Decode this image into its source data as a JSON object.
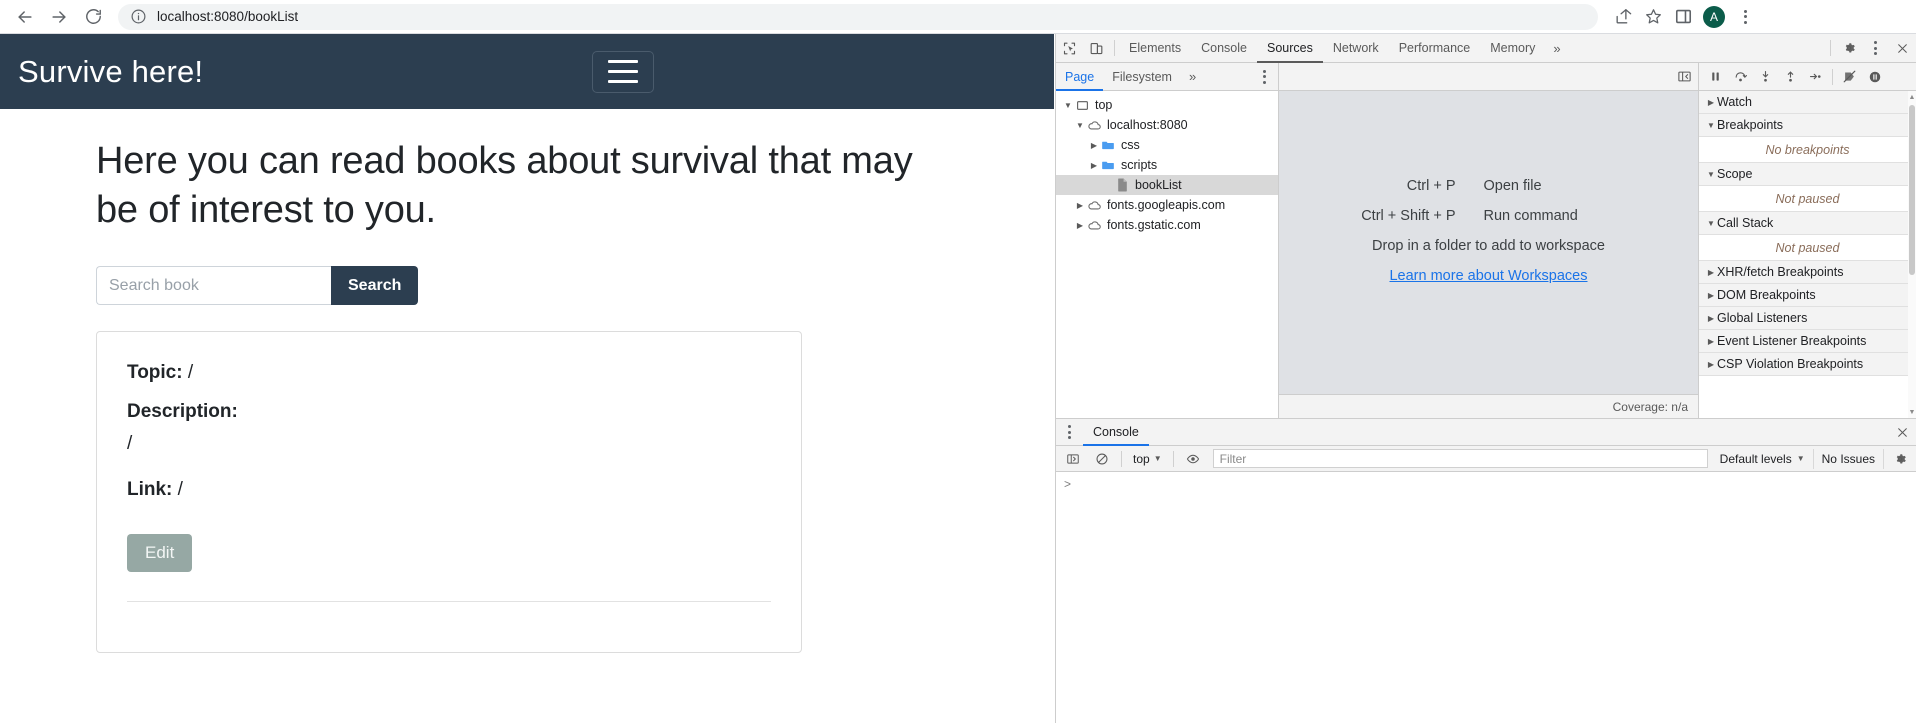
{
  "browser": {
    "back_icon": "arrow-left-icon",
    "forward_icon": "arrow-right-icon",
    "reload_icon": "reload-icon",
    "info_icon": "page-info-icon",
    "url_host": "localhost:8080",
    "url_path": "/bookList",
    "url_full": "localhost:8080/bookList",
    "share_icon": "share-icon",
    "bookmark_icon": "star-icon",
    "side_panel_icon": "side-panel-icon",
    "avatar_letter": "A",
    "menu_icon": "three-dot-menu-icon"
  },
  "page": {
    "header": {
      "title": "Survive here!",
      "toggler_icon": "hamburger-menu-icon",
      "background_color": "#2c3e50"
    },
    "lead": "Here you can read books about survival that may be of interest to you.",
    "search": {
      "placeholder": "Search book",
      "value": "",
      "button_label": "Search",
      "button_color": "#2c3e50"
    },
    "book": {
      "topic_label": "Topic:",
      "topic_value": "/",
      "description_label": "Description:",
      "description_value": "/",
      "link_label": "Link:",
      "link_value": "/",
      "edit_label": "Edit",
      "edit_color": "#96a8a4"
    }
  },
  "devtools": {
    "inspect_icon": "inspect-element-icon",
    "device_icon": "device-toolbar-icon",
    "tabs": [
      {
        "label": "Elements",
        "active": false
      },
      {
        "label": "Console",
        "active": false
      },
      {
        "label": "Sources",
        "active": true
      },
      {
        "label": "Network",
        "active": false
      },
      {
        "label": "Performance",
        "active": false
      },
      {
        "label": "Memory",
        "active": false
      }
    ],
    "more_tabs_icon": "chevron-double-right-icon",
    "settings_icon": "gear-icon",
    "more_options_icon": "three-dot-menu-icon",
    "close_icon": "close-icon",
    "navigator": {
      "tabs": [
        {
          "label": "Page",
          "active": true
        },
        {
          "label": "Filesystem",
          "active": false
        }
      ],
      "more_icon": "chevron-double-right-icon",
      "options_icon": "three-dot-menu-icon",
      "tree": [
        {
          "label": "top",
          "icon": "frame-icon",
          "depth": 0,
          "expanded": true,
          "selected": false
        },
        {
          "label": "localhost:8080",
          "icon": "cloud-icon",
          "depth": 1,
          "expanded": true,
          "selected": false
        },
        {
          "label": "css",
          "icon": "folder-icon",
          "depth": 2,
          "expanded": false,
          "selected": false
        },
        {
          "label": "scripts",
          "icon": "folder-icon",
          "depth": 2,
          "expanded": false,
          "selected": false
        },
        {
          "label": "bookList",
          "icon": "file-icon",
          "depth": 3,
          "expanded": null,
          "selected": true
        },
        {
          "label": "fonts.googleapis.com",
          "icon": "cloud-icon",
          "depth": 1,
          "expanded": false,
          "selected": false
        },
        {
          "label": "fonts.gstatic.com",
          "icon": "cloud-icon",
          "depth": 1,
          "expanded": false,
          "selected": false
        }
      ]
    },
    "editor": {
      "show_navigator_icon": "show-navigator-icon",
      "hints": [
        {
          "key": "Ctrl + P",
          "desc": "Open file"
        },
        {
          "key": "Ctrl + Shift + P",
          "desc": "Run command"
        }
      ],
      "drop_hint": "Drop in a folder to add to workspace",
      "workspaces_link": "Learn more about Workspaces",
      "coverage_status": "Coverage: n/a"
    },
    "debugger": {
      "pause_icon": "pause-icon",
      "step_over_icon": "step-over-icon",
      "step_into_icon": "step-into-icon",
      "step_out_icon": "step-out-icon",
      "step_icon": "step-icon",
      "deactivate_breakpoints_icon": "deactivate-breakpoints-icon",
      "pause_on_exceptions_icon": "pause-on-exceptions-icon",
      "sections": [
        {
          "label": "Watch",
          "expanded": false,
          "empty_text": null
        },
        {
          "label": "Breakpoints",
          "expanded": true,
          "empty_text": "No breakpoints"
        },
        {
          "label": "Scope",
          "expanded": true,
          "empty_text": "Not paused"
        },
        {
          "label": "Call Stack",
          "expanded": true,
          "empty_text": "Not paused"
        },
        {
          "label": "XHR/fetch Breakpoints",
          "expanded": false,
          "empty_text": null
        },
        {
          "label": "DOM Breakpoints",
          "expanded": false,
          "empty_text": null
        },
        {
          "label": "Global Listeners",
          "expanded": false,
          "empty_text": null
        },
        {
          "label": "Event Listener Breakpoints",
          "expanded": false,
          "empty_text": null
        },
        {
          "label": "CSP Violation Breakpoints",
          "expanded": false,
          "empty_text": null
        }
      ]
    },
    "console_drawer": {
      "options_icon": "three-dot-menu-icon",
      "tab_label": "Console",
      "close_icon": "close-icon",
      "sidebar_toggle_icon": "console-sidebar-icon",
      "clear_icon": "clear-console-icon",
      "context": "top",
      "eye_icon": "live-expression-icon",
      "filter_placeholder": "Filter",
      "filter_value": "",
      "levels_label": "Default levels",
      "issues_label": "No Issues",
      "settings_icon": "gear-icon",
      "prompt": ">"
    }
  }
}
